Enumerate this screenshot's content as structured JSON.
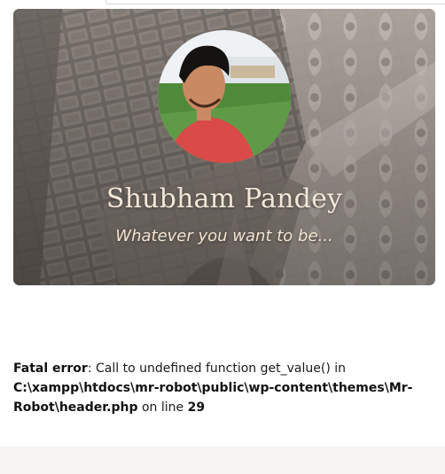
{
  "header": {
    "name": "Shubham Pandey",
    "tagline": "Whatever you want to be..."
  },
  "error": {
    "label": "Fatal error",
    "message": ": Call to undefined function get_value() in ",
    "path": "C:\\xampp\\htdocs\\mr-robot\\public\\wp-content\\themes\\Mr-Robot\\header.php",
    "on_line_text": " on line ",
    "line_number": "29"
  },
  "colors": {
    "name_text": "#f3e7d8",
    "footer_band": "#f8f4f2"
  }
}
